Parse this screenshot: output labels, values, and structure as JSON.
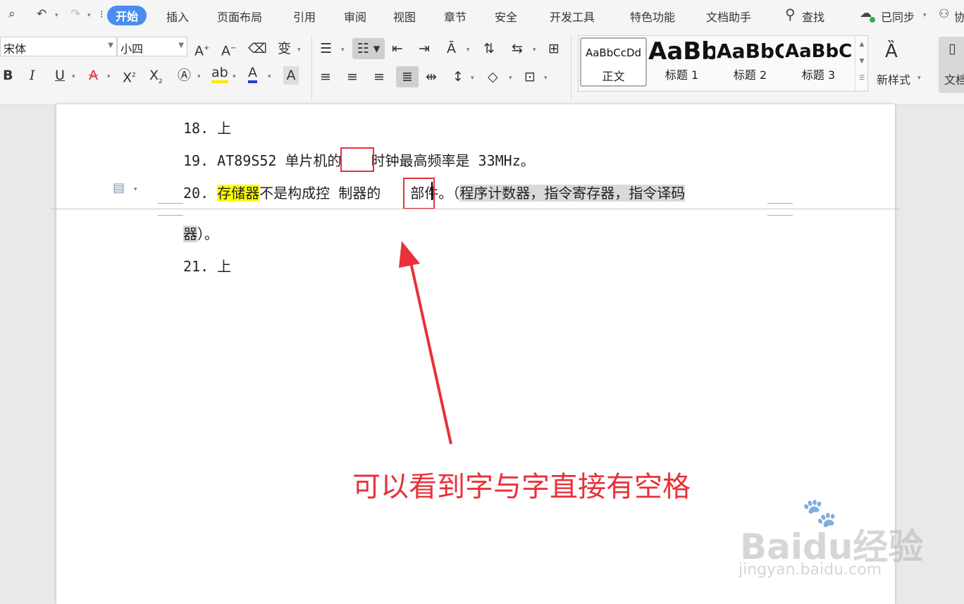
{
  "menubar": {
    "tabs": [
      "开始",
      "插入",
      "页面布局",
      "引用",
      "审阅",
      "视图",
      "章节",
      "安全",
      "开发工具",
      "特色功能",
      "文档助手"
    ],
    "active_tab": "开始",
    "search_label": "查找",
    "sync_label": "已同步",
    "collab_label": "协"
  },
  "ribbon": {
    "font_name": "宋体",
    "font_size": "小四",
    "styles": [
      {
        "preview": "AaBbCcDd",
        "name": "正文"
      },
      {
        "preview": "AaBb",
        "name": "标题 1"
      },
      {
        "preview": "AaBbC",
        "name": "标题 2"
      },
      {
        "preview": "AaBbC",
        "name": "标题 3"
      }
    ],
    "new_style_label": "新样式",
    "doc_label": "文档"
  },
  "document": {
    "line18_num": "18.",
    "line18_text": "上",
    "line19_num": "19.",
    "line19_text_a": "AT89S52 单片机的",
    "line19_text_b": "时钟最高频率是 33MHz。",
    "line20_num": "20.",
    "line20_highlight": "存储器",
    "line20_text_a": "不是构成控 制器的",
    "line20_text_b": "部件。",
    "line20_paren": "（",
    "line20_gray": "程序计数器，指令寄存器，指令译码",
    "line20b_gray": "器",
    "line20b_text": "）。",
    "line21_num": "21.",
    "line21_text": "上"
  },
  "annotation": {
    "caption": "可以看到字与字直接有空格",
    "color": "#e8313a"
  },
  "watermark": {
    "brand": "Baidu经验",
    "url": "jingyan.baidu.com"
  }
}
